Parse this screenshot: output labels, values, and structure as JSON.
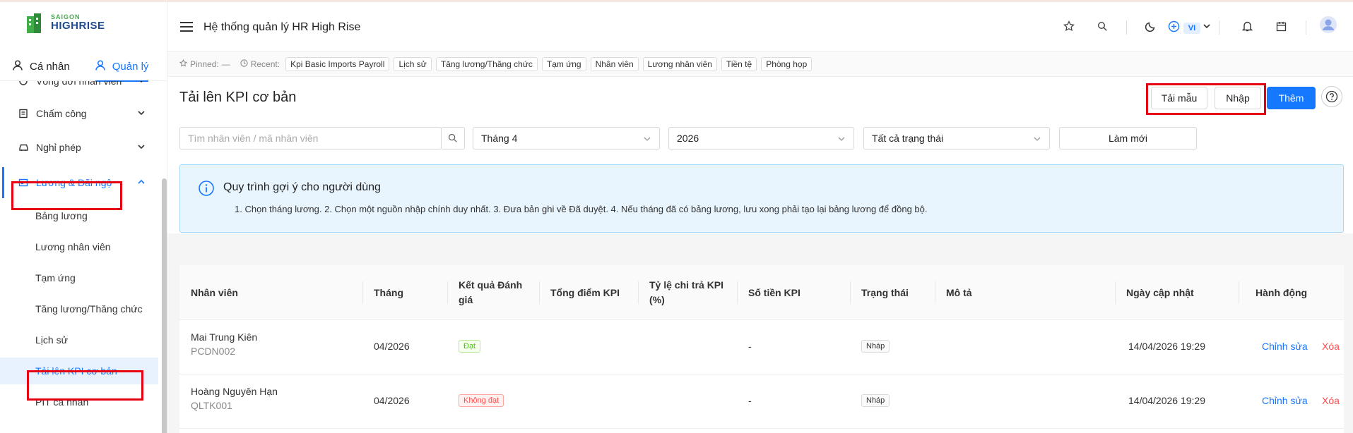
{
  "brand": {
    "top": "SAIGON",
    "bottom": "HIGHRISE"
  },
  "mode_tabs": [
    {
      "label": "Cá nhân"
    },
    {
      "label": "Quản lý"
    }
  ],
  "sidebar": {
    "groups": [
      {
        "label": "Vòng đời nhân viên"
      },
      {
        "label": "Chấm công"
      },
      {
        "label": "Nghỉ phép"
      },
      {
        "label": "Lương & Đãi ngộ"
      }
    ],
    "subitems": [
      {
        "label": "Bảng lương"
      },
      {
        "label": "Lương nhân viên"
      },
      {
        "label": "Tạm ứng"
      },
      {
        "label": "Tăng lương/Thăng chức"
      },
      {
        "label": "Lịch sử"
      },
      {
        "label": "Tải lên KPI cơ bản"
      },
      {
        "label": "PIT cá nhân"
      }
    ]
  },
  "header": {
    "title": "Hệ thống quản lý HR High Rise",
    "lang": "VI"
  },
  "recent": {
    "pinned_label": "Pinned:",
    "pinned_value": "—",
    "recent_label": "Recent:",
    "chips": [
      "Kpi Basic Imports Payroll",
      "Lịch sử",
      "Tăng lương/Thăng chức",
      "Tạm ứng",
      "Nhân viên",
      "Lương nhân viên",
      "Tiền tệ",
      "Phòng họp"
    ]
  },
  "page": {
    "title": "Tải lên KPI cơ bản",
    "btn_template": "Tải mẫu",
    "btn_import": "Nhập",
    "btn_add": "Thêm"
  },
  "filters": {
    "search_placeholder": "Tìm nhân viên / mã nhân viên",
    "month": "Tháng 4",
    "year": "2026",
    "status": "Tất cả trạng thái",
    "refresh": "Làm mới"
  },
  "info": {
    "title": "Quy trình gợi ý cho người dùng",
    "body": "1. Chọn tháng lương. 2. Chọn một nguồn nhập chính duy nhất. 3. Đưa bản ghi về Đã duyệt. 4. Nếu tháng đã có bảng lương, lưu xong phải tạo lại bảng lương để đồng bộ."
  },
  "table": {
    "columns": [
      "Nhân viên",
      "Tháng",
      "Kết quả Đánh giá",
      "Tổng điểm KPI",
      "Tỷ lệ chi trả KPI (%)",
      "Số tiền KPI",
      "Trạng thái",
      "Mô tả",
      "Ngày cập nhật",
      "Hành động"
    ],
    "rows": [
      {
        "name": "Mai Trung Kiên",
        "code": "PCDN002",
        "month": "04/2026",
        "result": "Đạt",
        "score": "",
        "rate": "",
        "amount": "-",
        "status": "Nháp",
        "desc": "",
        "updated": "14/04/2026 19:29",
        "edit": "Chỉnh sửa",
        "delete": "Xóa"
      },
      {
        "name": "Hoàng Nguyên Hạn",
        "code": "QLTK001",
        "month": "04/2026",
        "result": "Không đạt",
        "score": "",
        "rate": "",
        "amount": "-",
        "status": "Nháp",
        "desc": "",
        "updated": "14/04/2026 19:29",
        "edit": "Chỉnh sửa",
        "delete": "Xóa"
      }
    ]
  },
  "colors": {
    "primary": "#1677ff",
    "highlight": "#e60012"
  }
}
